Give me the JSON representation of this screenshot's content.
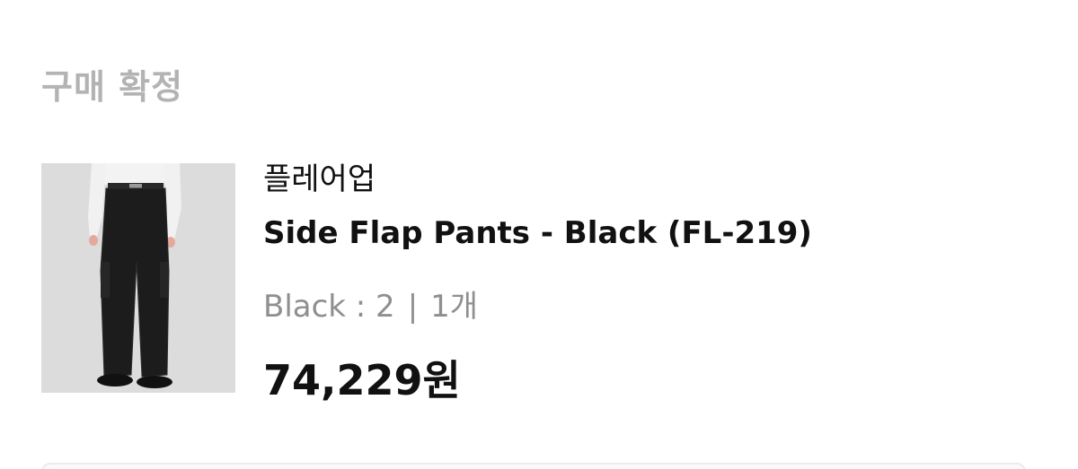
{
  "status": {
    "title": "구매 확정"
  },
  "order_item": {
    "brand": "플레어업",
    "product_name": "Side Flap Pants - Black (FL-219)",
    "option": "Black : 2",
    "separator": "|",
    "quantity": "1개",
    "price": "74,229원",
    "image": "product-photo"
  },
  "colors": {
    "status_title": "#b3b3b3",
    "primary_text": "#111111",
    "secondary_text": "#8f8f8f",
    "thumb_background": "#dcdcdc"
  }
}
